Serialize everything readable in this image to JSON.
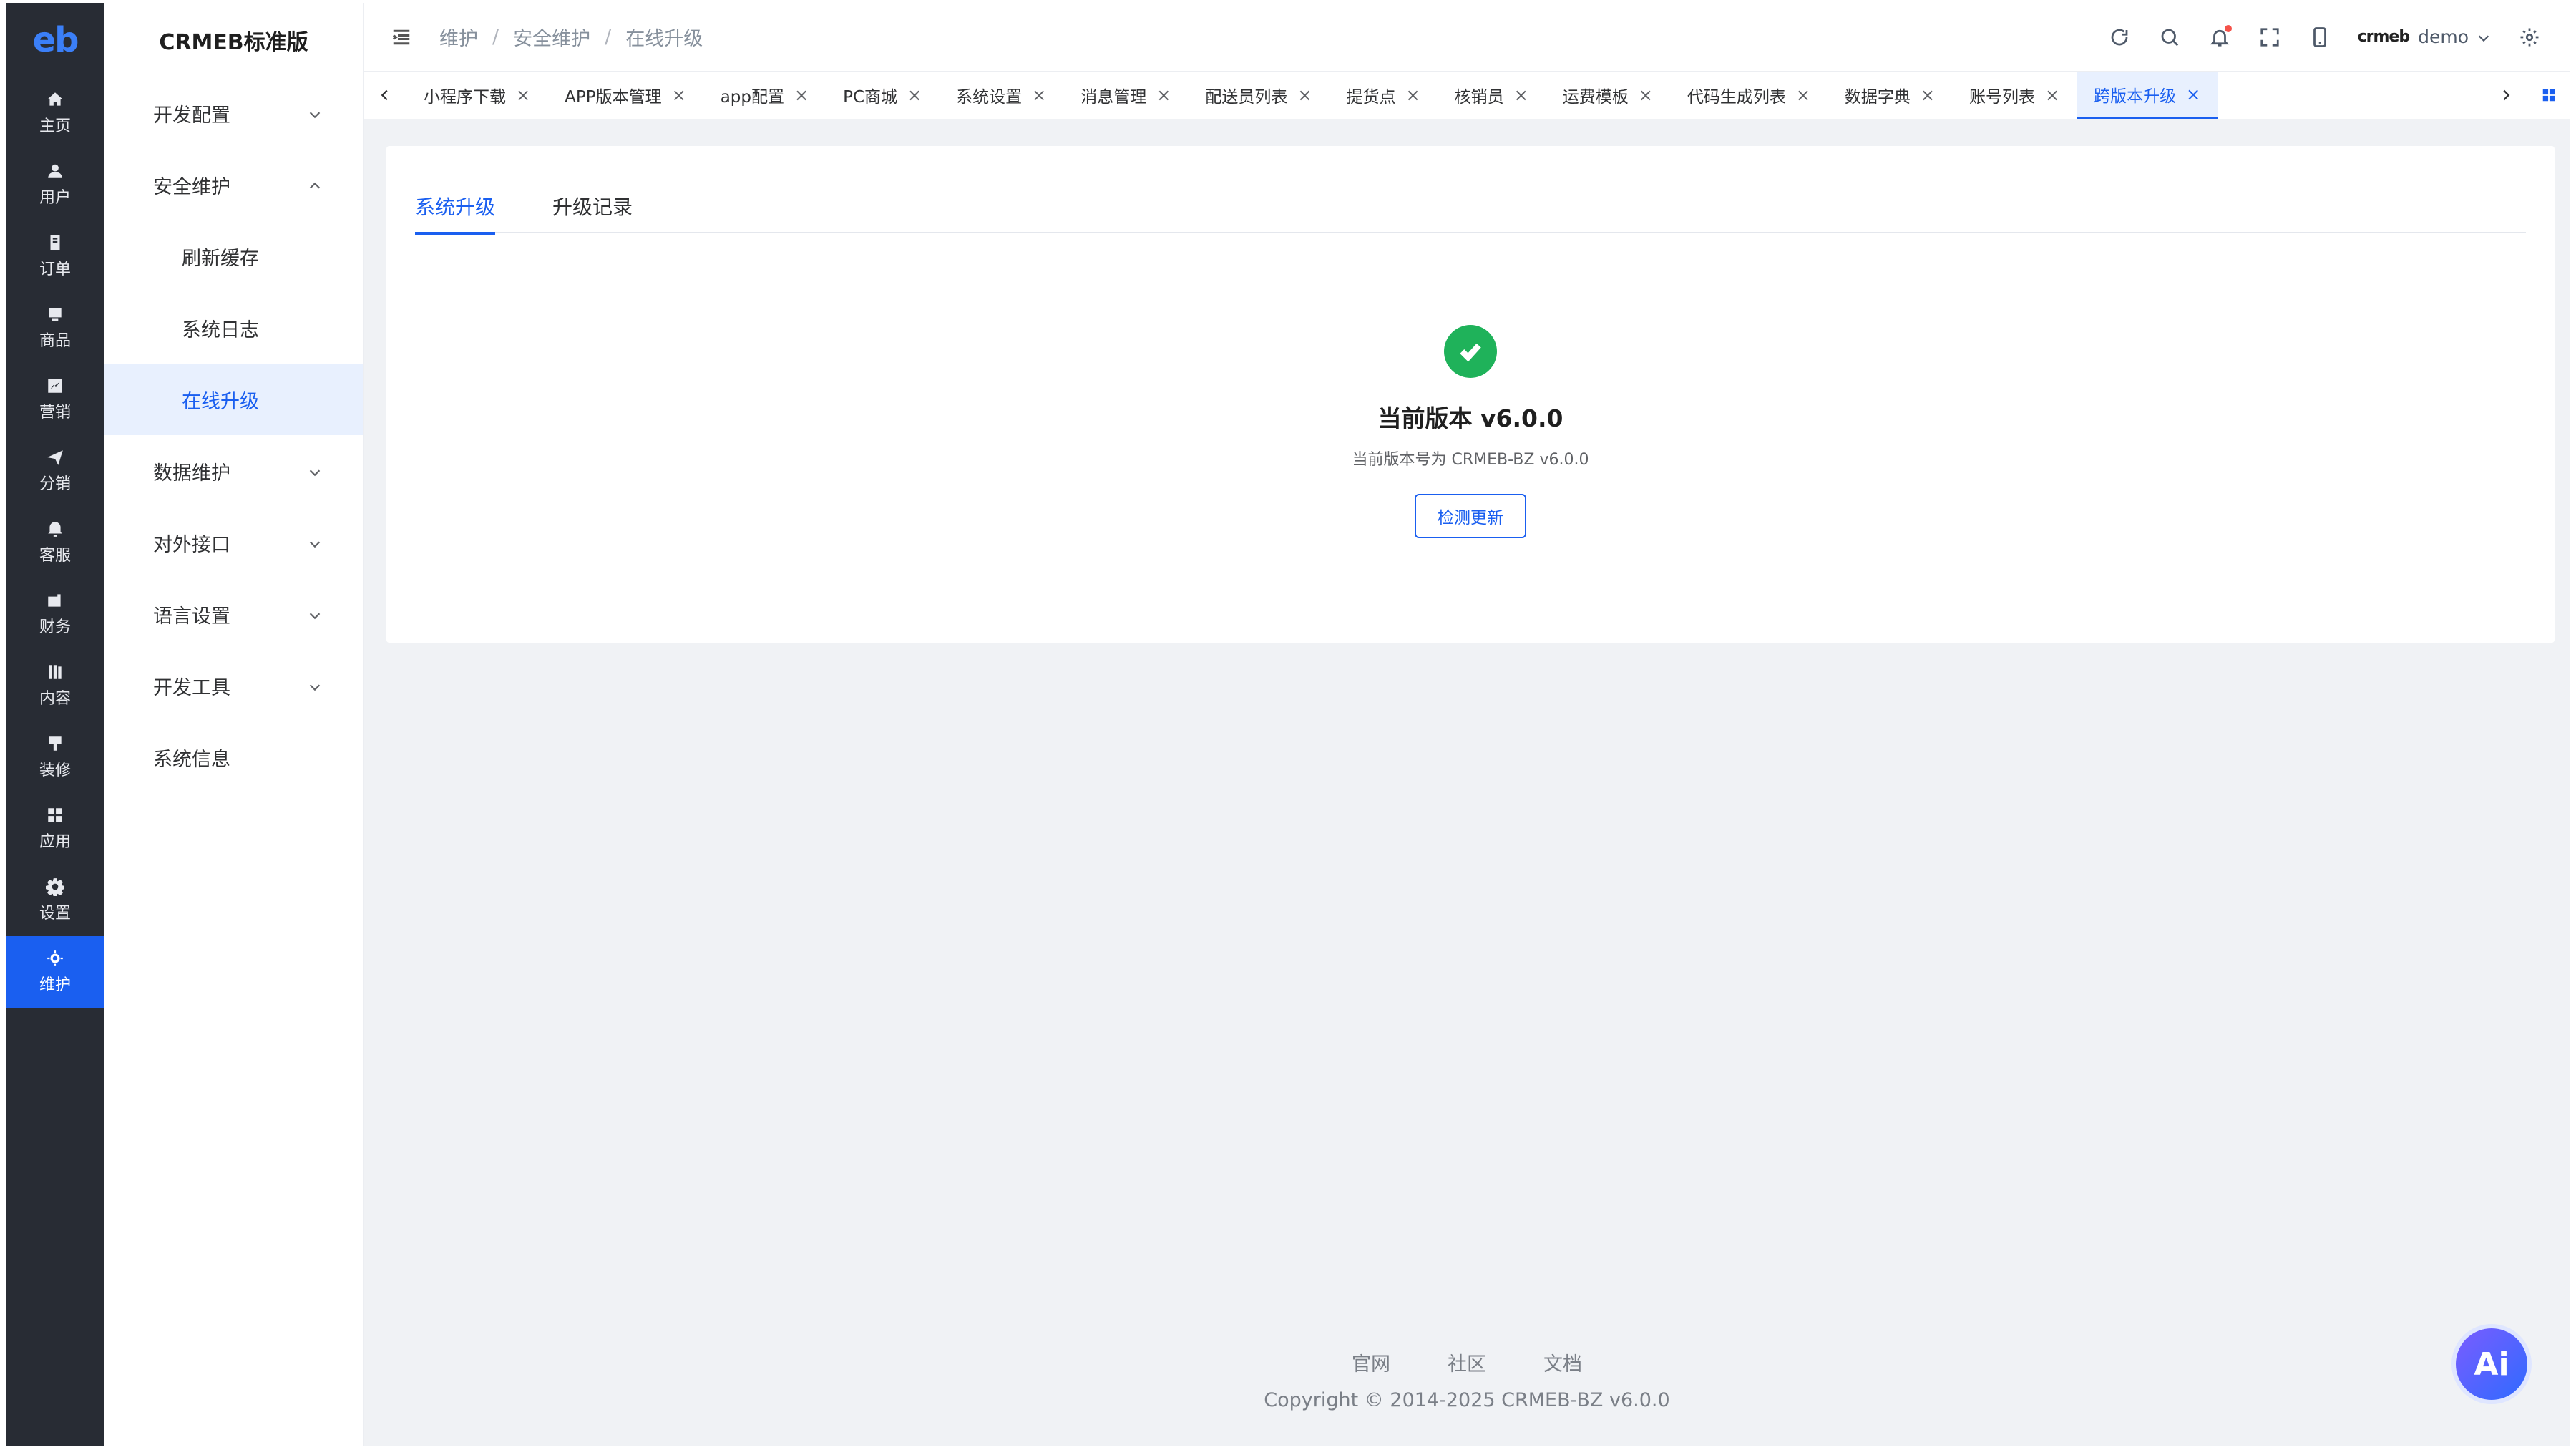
{
  "rail": {
    "logo": "eb",
    "items": [
      {
        "label": "主页",
        "icon": "home-icon"
      },
      {
        "label": "用户",
        "icon": "user-icon"
      },
      {
        "label": "订单",
        "icon": "order-icon"
      },
      {
        "label": "商品",
        "icon": "product-icon"
      },
      {
        "label": "营销",
        "icon": "marketing-icon"
      },
      {
        "label": "分销",
        "icon": "distribution-icon"
      },
      {
        "label": "客服",
        "icon": "service-bell-icon"
      },
      {
        "label": "财务",
        "icon": "finance-icon"
      },
      {
        "label": "内容",
        "icon": "content-icon"
      },
      {
        "label": "装修",
        "icon": "brush-icon"
      },
      {
        "label": "应用",
        "icon": "apps-grid-icon"
      },
      {
        "label": "设置",
        "icon": "gear-icon"
      },
      {
        "label": "维护",
        "icon": "maintenance-icon",
        "active": true
      }
    ]
  },
  "submenu": {
    "title": "CRMEB标准版",
    "items": [
      {
        "label": "开发配置"
      },
      {
        "label": "安全维护"
      },
      {
        "label": "刷新缓存"
      },
      {
        "label": "系统日志"
      },
      {
        "label": "在线升级"
      },
      {
        "label": "数据维护"
      },
      {
        "label": "对外接口"
      },
      {
        "label": "语言设置"
      },
      {
        "label": "开发工具"
      },
      {
        "label": "系统信息"
      }
    ]
  },
  "header": {
    "breadcrumb": [
      "维护",
      "安全维护",
      "在线升级"
    ],
    "separator": "/",
    "brand": "crmeb",
    "user": "demo"
  },
  "tabs": [
    {
      "label": "小程序下载"
    },
    {
      "label": "APP版本管理"
    },
    {
      "label": "app配置"
    },
    {
      "label": "PC商城"
    },
    {
      "label": "系统设置"
    },
    {
      "label": "消息管理"
    },
    {
      "label": "配送员列表"
    },
    {
      "label": "提货点"
    },
    {
      "label": "核销员"
    },
    {
      "label": "运费模板"
    },
    {
      "label": "代码生成列表"
    },
    {
      "label": "数据字典"
    },
    {
      "label": "账号列表"
    },
    {
      "label": "跨版本升级",
      "active": true
    }
  ],
  "content": {
    "tabs": [
      "系统升级",
      "升级记录"
    ],
    "version_title": "当前版本 v6.0.0",
    "version_sub": "当前版本号为 CRMEB-BZ v6.0.0",
    "check_button": "检测更新"
  },
  "footer": {
    "links": [
      "官网",
      "社区",
      "文档"
    ],
    "copyright": "Copyright © 2014-2025 CRMEB-BZ v6.0.0"
  },
  "ai_label": "Ai",
  "colors": {
    "accent": "#1a5ff0",
    "rail_bg": "#282c34",
    "success": "#1fb25a"
  }
}
